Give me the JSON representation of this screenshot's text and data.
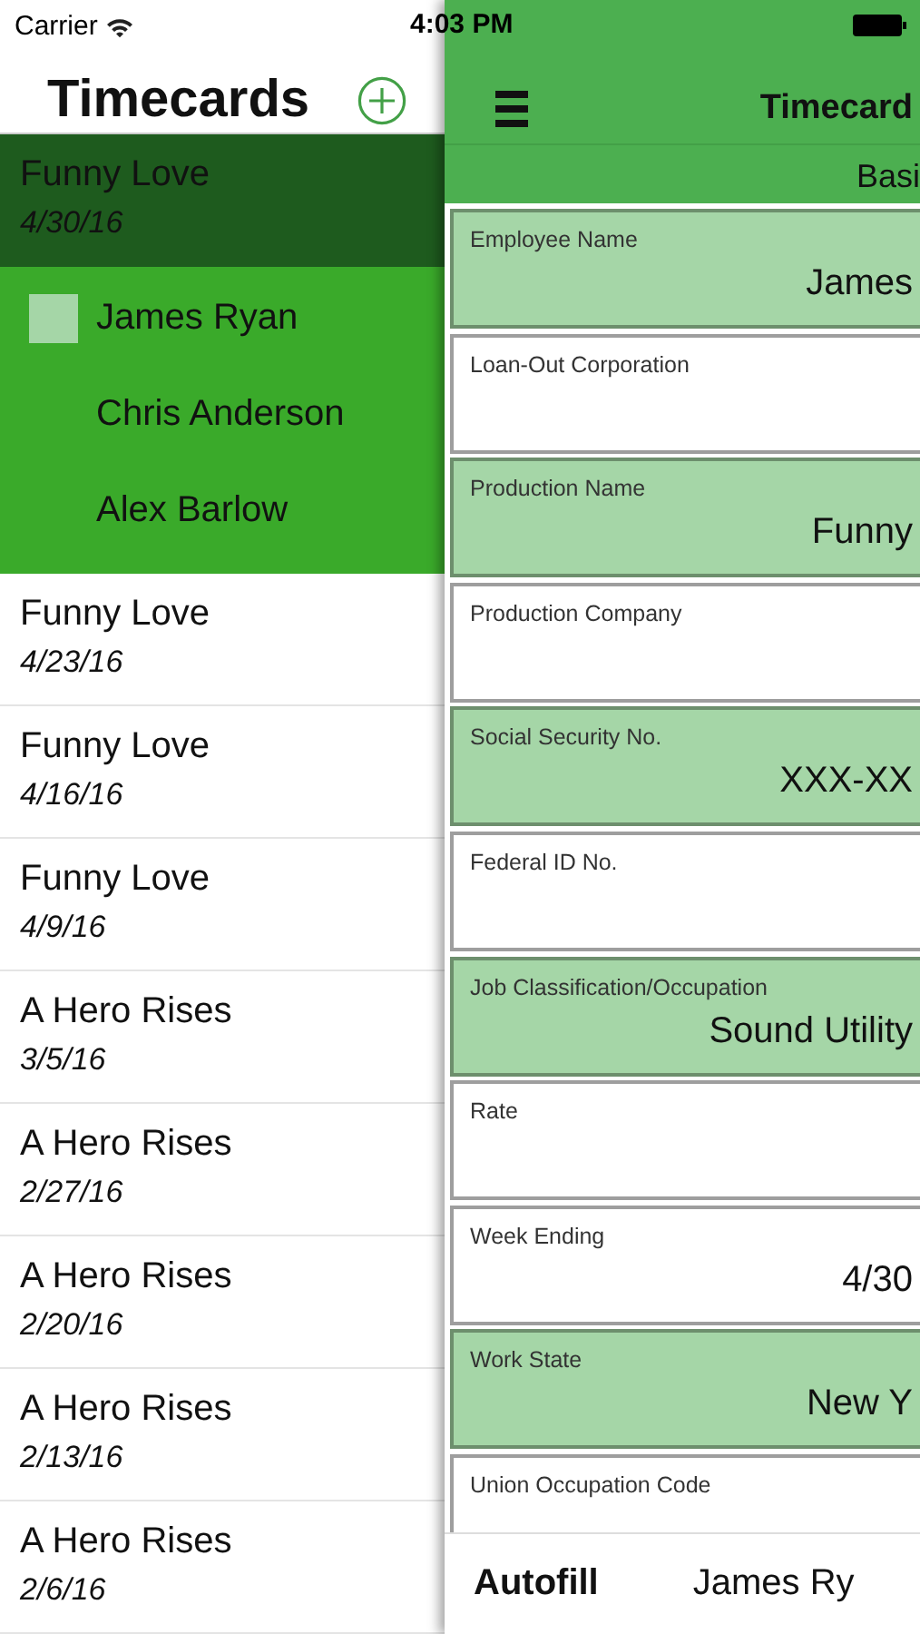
{
  "status_bar": {
    "carrier": "Carrier",
    "time": "4:03 PM"
  },
  "sidebar": {
    "title": "Timecards",
    "items": [
      {
        "title": "Funny Love",
        "date": "4/30/16",
        "selected": true,
        "expanded": true,
        "children": [
          {
            "name": "James Ryan",
            "selected": true
          },
          {
            "name": "Chris Anderson",
            "selected": false
          },
          {
            "name": "Alex Barlow",
            "selected": false
          }
        ]
      },
      {
        "title": "Funny Love",
        "date": "4/23/16",
        "selected": false
      },
      {
        "title": "Funny Love",
        "date": "4/16/16",
        "selected": false
      },
      {
        "title": "Funny Love",
        "date": "4/9/16",
        "selected": false
      },
      {
        "title": "A Hero Rises",
        "date": "3/5/16",
        "selected": false
      },
      {
        "title": "A Hero Rises",
        "date": "2/27/16",
        "selected": false
      },
      {
        "title": "A Hero Rises",
        "date": "2/20/16",
        "selected": false
      },
      {
        "title": "A Hero Rises",
        "date": "2/13/16",
        "selected": false
      },
      {
        "title": "A Hero Rises",
        "date": "2/6/16",
        "selected": false
      }
    ]
  },
  "detail": {
    "title": "Timecard",
    "section": "Basi",
    "fields": [
      {
        "label": "Employee Name",
        "value": "James",
        "filled": true
      },
      {
        "label": "Loan-Out Corporation",
        "filled": false
      },
      {
        "label": "Production Name",
        "value": "Funny",
        "filled": true
      },
      {
        "label": "Production Company",
        "filled": false
      },
      {
        "label": "Social Security No.",
        "value": "XXX-XX",
        "filled": true
      },
      {
        "label": "Federal ID No.",
        "filled": false
      },
      {
        "label": "Job Classification/Occupation",
        "value": "Sound Utility",
        "filled": true
      },
      {
        "label": "Rate",
        "filled": false
      },
      {
        "label": "Week Ending",
        "value": "4/30",
        "filled": false
      },
      {
        "label": "Work State",
        "value": "New Y",
        "filled": true
      },
      {
        "label": "Union Occupation Code",
        "filled": false
      }
    ],
    "autofill": {
      "label": "Autofill",
      "value": "James Ry"
    }
  }
}
